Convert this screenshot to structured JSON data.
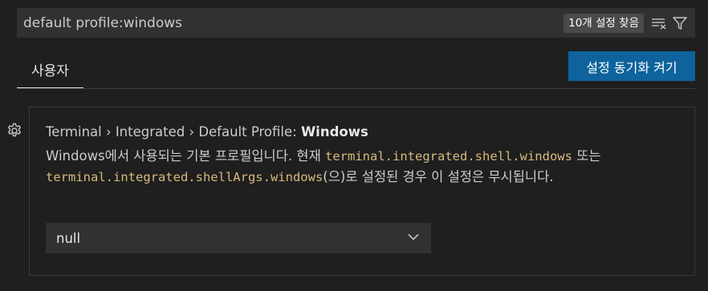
{
  "search": {
    "value": "default profile:windows",
    "results_badge": "10개 설정 찾음",
    "clear_filter_icon": "clear-filter-icon",
    "filter_icon": "filter-icon"
  },
  "tabs": [
    {
      "label": "사용자",
      "active": true
    }
  ],
  "sync_button": {
    "label": "설정 동기화 켜기"
  },
  "setting": {
    "breadcrumb": "Terminal › Integrated › Default Profile: ",
    "name": "Windows",
    "desc_part1": "Windows에서 사용되는 기본 프로필입니다. 현재 ",
    "desc_code1": "terminal.integrated.shell.windows",
    "desc_part2": " 또는 ",
    "desc_code2": "terminal.integrated.shellArgs.windows",
    "desc_part3": "(으)로 설정된 경우 이 설정은 무시됩니다.",
    "select_value": "null",
    "gear_icon": "gear-icon"
  },
  "colors": {
    "background": "#1f1f1f",
    "input_bg": "#313131",
    "accent_button": "#0e639c",
    "code_text": "#d7ba7d"
  }
}
